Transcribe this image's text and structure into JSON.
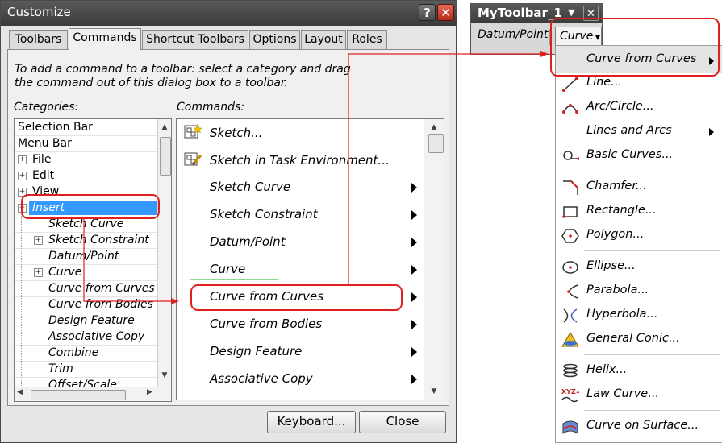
{
  "dialog": {
    "title": "Customize",
    "help_glyph": "?",
    "close_glyph": "✕",
    "tabs": [
      "Toolbars",
      "Commands",
      "Shortcut Toolbars",
      "Options",
      "Layout",
      "Roles"
    ],
    "active_tab": "Commands",
    "instructions": "To add a command to a toolbar: select a category and drag the command out of this dialog box to a toolbar.",
    "categories_label": "Categories:",
    "commands_label": "Commands:",
    "categories": [
      "Selection Bar",
      "Menu Bar",
      "File",
      "Edit",
      "View",
      "Insert",
      "Sketch Curve",
      "Sketch Constraint",
      "Datum/Point",
      "Curve",
      "Curve from Curves",
      "Curve from Bodies",
      "Design Feature",
      "Associative Copy",
      "Combine",
      "Trim",
      "Offset/Scale"
    ],
    "selected_category": "Insert",
    "commands": [
      "Sketch...",
      "Sketch in Task Environment...",
      "Sketch Curve",
      "Sketch Constraint",
      "Datum/Point",
      "Curve",
      "Curve from Curves",
      "Curve from Bodies",
      "Design Feature",
      "Associative Copy"
    ],
    "keyboard_button": "Keyboard...",
    "close_button": "Close"
  },
  "toolbar_window": {
    "title": "MyToolbar_1",
    "dropdown_glyph": "▼",
    "close_glyph": "✕",
    "items": [
      "Datum/Point",
      "Curve"
    ]
  },
  "menu": {
    "items": [
      "Curve from Curves",
      "Line...",
      "Arc/Circle...",
      "Lines and Arcs",
      "Basic Curves...",
      "Chamfer...",
      "Rectangle...",
      "Polygon...",
      "Ellipse...",
      "Parabola...",
      "Hyperbola...",
      "General Conic...",
      "Helix...",
      "Law Curve...",
      "Curve on Surface..."
    ]
  },
  "colors": {
    "highlight_red": "#e02020",
    "selection_blue": "#3399ff",
    "drop_green": "#90d890",
    "title_dark": "#3b3b3b"
  }
}
